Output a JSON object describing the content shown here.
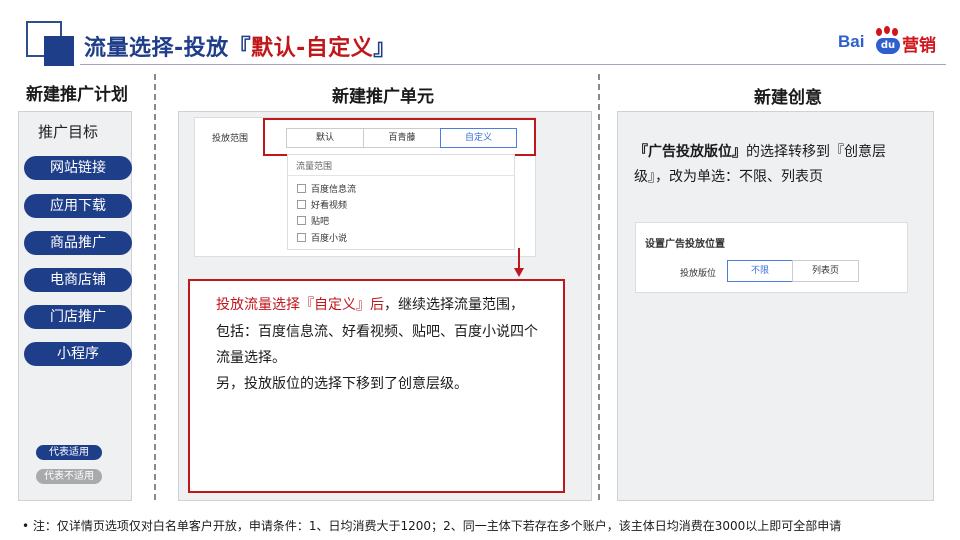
{
  "header": {
    "title_prefix": "流量选择-投放『",
    "title_highlight": "默认-自定义",
    "title_suffix": "』",
    "logo_bai": "Bai",
    "logo_du": "du",
    "logo_yingxiao": "营销"
  },
  "columns": {
    "left_title": "新建推广计划",
    "middle_title": "新建推广单元",
    "right_title": "新建创意"
  },
  "left_panel": {
    "heading": "推广目标",
    "items": [
      "网站链接",
      "应用下载",
      "商品推广",
      "电商店铺",
      "门店推广",
      "小程序"
    ],
    "legend_applicable": "代表适用",
    "legend_not_applicable": "代表不适用"
  },
  "middle_panel": {
    "field_label": "投放范围",
    "segments": [
      "默认",
      "百青藤",
      "自定义"
    ],
    "active_segment": "自定义",
    "dropdown_title": "流量范围",
    "options": [
      "百度信息流",
      "好看视频",
      "贴吧",
      "百度小说"
    ],
    "note_red": "投放流量选择『自定义』后",
    "note_line1_rest": "，继续选择流量范围，",
    "note_line2": "包括：百度信息流、好看视频、贴吧、百度小说四个",
    "note_line3": "流量选择。",
    "note_line4": "另，投放版位的选择下移到了创意层级。"
  },
  "right_panel": {
    "text_bold": "『广告投放版位』",
    "text_line1_rest": "的选择转移到『创意层",
    "text_line2": "级』，改为单选：不限、列表页",
    "card_title": "设置广告投放位置",
    "field_label": "投放版位",
    "options": [
      "不限",
      "列表页"
    ],
    "active_option": "不限"
  },
  "footer": {
    "note": "•   注：仅详情页选项仅对白名单客户开放，申请条件：1、日均消费大于1200；2、同一主体下若存在多个账户，该主体日均消费在3000以上即可全部申请"
  },
  "colors": {
    "brand_blue": "#1f3e8a",
    "accent_red": "#c0171b",
    "panel_bg": "#eff0f2",
    "legend_gray": "#a9aaad",
    "selected_blue": "#3a6fd8"
  }
}
